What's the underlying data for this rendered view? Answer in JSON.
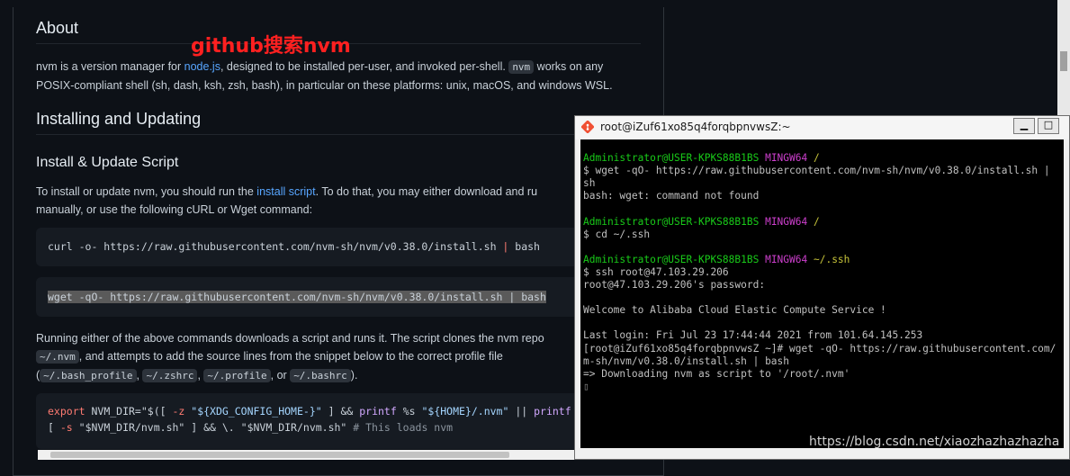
{
  "annotation": "github搜索nvm",
  "readme": {
    "about_heading": "About",
    "about_p1": "nvm is a version manager for ",
    "about_link": "node.js",
    "about_p2": ", designed to be installed per-user, and invoked per-shell. ",
    "about_code": "nvm",
    "about_p3": " works on any",
    "about_line2": "POSIX-compliant shell (sh, dash, ksh, zsh, bash), in particular on these platforms: unix, macOS, and windows WSL.",
    "install_heading": "Installing and Updating",
    "script_heading": "Install & Update Script",
    "install_p1": "To install or update nvm, you should run the ",
    "install_link": "install script",
    "install_p2": ". To do that, you may either download and ru",
    "install_line2": "manually, or use the following cURL or Wget command:",
    "curl_cmd": "curl -o- https://raw.githubusercontent.com/nvm-sh/nvm/v0.38.0/install.sh ",
    "pipe": "|",
    "bash": " bash",
    "wget_cmd": "wget -qO- https://raw.githubusercontent.com/nvm-sh/nvm/v0.38.0/install.sh | bash",
    "running_line1": "Running either of the above commands downloads a script and runs it. The script clones the nvm repo",
    "running_code": "~/.nvm",
    "running_line2": ", and attempts to add the source lines from the snippet below to the correct profile file",
    "profiles": [
      "~/.bash_profile",
      "~/.zshrc",
      "~/.profile",
      "~/.bashrc"
    ],
    "export_kw": "export",
    "export_rest1": " NVM_DIR=\"$([ ",
    "export_z": "-z",
    "export_str1": " \"${XDG_CONFIG_HOME-}\"",
    "export_rest2": " ] && ",
    "export_printf": "printf",
    "export_rest3": " %s ",
    "export_str2": "\"${HOME}/.nvm\"",
    "export_rest4": " || ",
    "export_printf2": "printf",
    "line2_a": "[ ",
    "line2_s": "-s",
    "line2_b": " \"$NVM_DIR/nvm.sh\" ] && \\. \"$NVM_DIR/nvm.sh\" ",
    "line2_cmt": "# This loads nvm"
  },
  "terminal": {
    "title": "root@iZuf61xo85q4forqbpnvwsZ:~",
    "minimize": "▁",
    "maximize": "□",
    "user1": "Administrator@USER-KPKS88B1BS",
    "shell": "MINGW64",
    "path1": "/",
    "l2": "$ wget -qO- https://raw.githubusercontent.com/nvm-sh/nvm/v0.38.0/install.sh |",
    "l3": "sh",
    "l4": "bash: wget: command not found",
    "path2": "/",
    "l7": "$ cd ~/.ssh",
    "path3": "~/.ssh",
    "l10": "$ ssh root@47.103.29.206",
    "l11": "root@47.103.29.206's password:",
    "l13": "Welcome to Alibaba Cloud Elastic Compute Service !",
    "l15": "Last login: Fri Jul 23 17:44:44 2021 from 101.64.145.253",
    "l16": "[root@iZuf61xo85q4forqbpnvwsZ ~]# wget -qO- https://raw.githubusercontent.com/",
    "l17": "m-sh/nvm/v0.38.0/install.sh | bash",
    "l18": "=> Downloading nvm as script to '/root/.nvm'",
    "cursor": "▯"
  },
  "watermark": "https://blog.csdn.net/xiaozhazhazhazha",
  "colors": {
    "background": "#0d1117",
    "link": "#58a6ff",
    "terminal_green": "#19cb19",
    "terminal_magenta": "#cd3fcd",
    "terminal_yellow": "#c7c43a",
    "annotation_red": "#ff2020"
  }
}
